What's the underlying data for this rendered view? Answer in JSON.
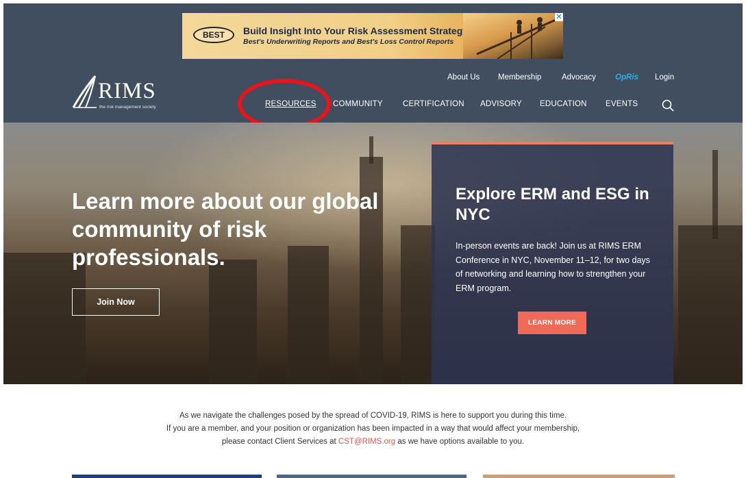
{
  "ad": {
    "logo_text": "BEST",
    "title": "Build Insight Into Your Risk Assessment Strategy",
    "subtitle": "Best's Underwriting Reports and Best's Loss Control Reports",
    "close": "✕"
  },
  "logo": {
    "name": "RIMS",
    "tagline": "the risk management society"
  },
  "utility_nav": {
    "about": "About Us",
    "membership": "Membership",
    "advocacy": "Advocacy",
    "opis": "OpRis",
    "login": "Login"
  },
  "main_nav": {
    "resources": "RESOURCES",
    "community": "COMMUNITY",
    "certification": "CERTIFICATION",
    "advisory": "ADVISORY",
    "education": "EDUCATION",
    "events": "EVENTS"
  },
  "hero": {
    "headline": "Learn more about our global community of risk professionals.",
    "join_label": "Join Now"
  },
  "card": {
    "title": "Explore ERM and ESG in NYC",
    "text": "In-person events are back! Join us at RIMS ERM Conference in NYC, November 11–12, for two days of networking and learning how to strengthen your ERM program.",
    "button": "LEARN MORE"
  },
  "notice": {
    "line1": "As we navigate the challenges posed by the spread of COVID-19, RIMS is here to support you during this time.",
    "line2": "If you are a member, and your position or organization has been impacted in a way that would affect your membership,",
    "line3_pre": "please contact Client Services at ",
    "email": "CST@RIMS.org",
    "line3_post": " as we have options available to you."
  },
  "colors": {
    "header_bg": "#404e5f",
    "accent": "#ef6a57",
    "highlight": "#e8141c",
    "opis": "#2ab0e8"
  }
}
